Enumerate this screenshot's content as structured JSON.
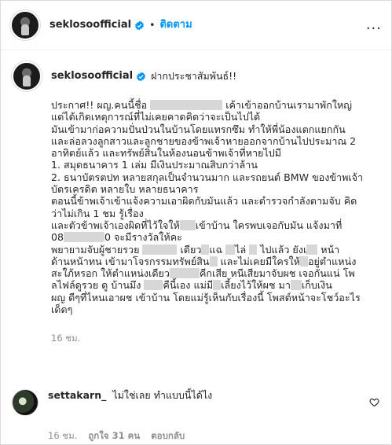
{
  "header": {
    "username": "seklosoofficial",
    "separator": "•",
    "follow_label": "ติดตาม",
    "more_label": "..."
  },
  "post": {
    "username": "seklosoofficial",
    "caption_title": "ฝากประชาสัมพันธ์!!",
    "lines": [
      [
        "ประกาศ!! ผญ.คนนี้ชื่อ ",
        "R:92",
        " เค้าเข้าออกบ้านเรามาพักใหญ่"
      ],
      [
        "แต่ได้เกิดเหตุการณ์ที่ไม่เคยคาดคิดว่าจะเป็นไปได้"
      ],
      [
        "มันเข้ามาก่อความปั่นป่วนในบ้านโดยแทรกซึม ทำให้พี่น้องแตกแยกกัน"
      ],
      [
        "และล่อลวงลูกสาวและลูกชายของข้าพเจ้าหายออกจากบ้านไปประมาณ 2"
      ],
      [
        "อาทิตย์แล้ว และทรัพย์สินในห้องนอนข้าพเจ้าที่หายไปมี"
      ],
      [
        "1. สมุดธนาคาร 1 เล่ม มีเงินประมาณสิบกว่าล้าน"
      ],
      [
        "2. ธนาบัตรตปท หลายสกุลเป็นจำนวนมาก และรถยนต์ BMW ของข้าพเจ้า"
      ],
      [
        "บัตรเครดิต หลายใบ หลายธนาคาร"
      ],
      [
        "ตอนนี้ข้าพเจ้าเข้าแจ้งความเอาผิดกับมันแล้ว และตำรวจกำลังตามจับ คิด"
      ],
      [
        "ว่าไม่เกิน 1 ชม รู้เรื่อง"
      ],
      [
        "และตัวข้าพเจ้าเองผิดที่ไว้ใจให้",
        "R:20",
        "เข้าบ้าน ใครพบเจอกับมัน แจ้งมาที่"
      ],
      [
        "08",
        "R:52",
        "0 จะมีรางวัลให้คะ"
      ],
      [
        "พยายามจับผู้ชายรวย ",
        "R:44",
        " เดียว",
        "R:10",
        "แฉ ",
        "R:12",
        "ไล่ ",
        "R:10",
        " ไปแล้ว ยังเ",
        "R:14",
        " หน้า"
      ],
      [
        "ด้านหน้าทน เข้ามาโจรกรรมทรัพย์สิน",
        "R:10",
        " และไม่เคยมีใครให้",
        "R:10",
        "อยู่ตำแหน่ง"
      ],
      [
        "สะใภ้หรอก ให้ตำแหน่งเดียว",
        "R:38",
        "คีกเสีย หนีเสียมาจับผช เจอกันแน่ โพ"
      ],
      [
        "ลไฟล์ดูรวย ดู บ้านมึง ",
        "R:24",
        "คืนี้เอง แม่มี",
        "R:10",
        "เลี้ยงไว้ให้ผช มา",
        "R:14",
        "เก็บเงิน"
      ],
      [
        "ผญ ดีๆที่ไหนเอาผช เข้าบ้าน โดยแม่รู้เห็นกับเรื่องนี้ โพสต์หน้าจะโชว์อะไร"
      ],
      [
        "เด็ดๆ"
      ]
    ],
    "timestamp": "16 ชม."
  },
  "comment": {
    "username": "settakarn_",
    "text": "ไม่ใช่เลย ทำแบบนี้ได้ไง",
    "time": "16 ชม.",
    "likes": "ถูกใจ 31 คน",
    "reply_label": "ตอบกลับ"
  },
  "colors": {
    "accent": "#0095f6",
    "muted": "#8e8e8e",
    "redaction": "#d7d7d7"
  },
  "icons": {
    "verified": "verified-badge-icon",
    "more": "more-options-icon",
    "like": "heart-icon"
  }
}
